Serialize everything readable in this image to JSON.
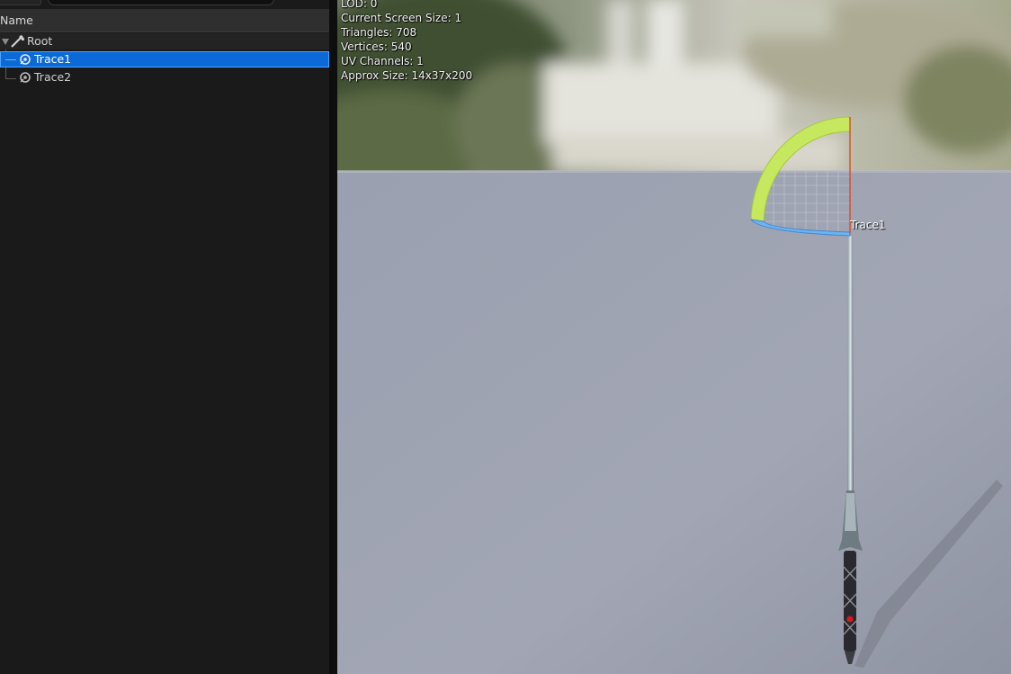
{
  "outliner": {
    "header_label": "Name",
    "items": [
      {
        "label": "Root",
        "icon": "bone-icon"
      },
      {
        "label": "Trace1",
        "icon": "socket-icon",
        "selected": true
      },
      {
        "label": "Trace2",
        "icon": "socket-icon"
      }
    ]
  },
  "viewport": {
    "stats": [
      "LOD: 0",
      "Current Screen Size: 1",
      "Triangles: 708",
      "Vertices: 540",
      "UV Channels: 1",
      "Approx Size: 14x37x200"
    ],
    "socket_label": "Trace1"
  },
  "colors": {
    "selection": "#0b6ad8",
    "panel_bg": "#1a1a1a",
    "header_bg": "#2f2f2f",
    "floor": "#9ca0ae",
    "gizmo_arc": "#c4e85a",
    "gizmo_axis": "#e0491f"
  }
}
